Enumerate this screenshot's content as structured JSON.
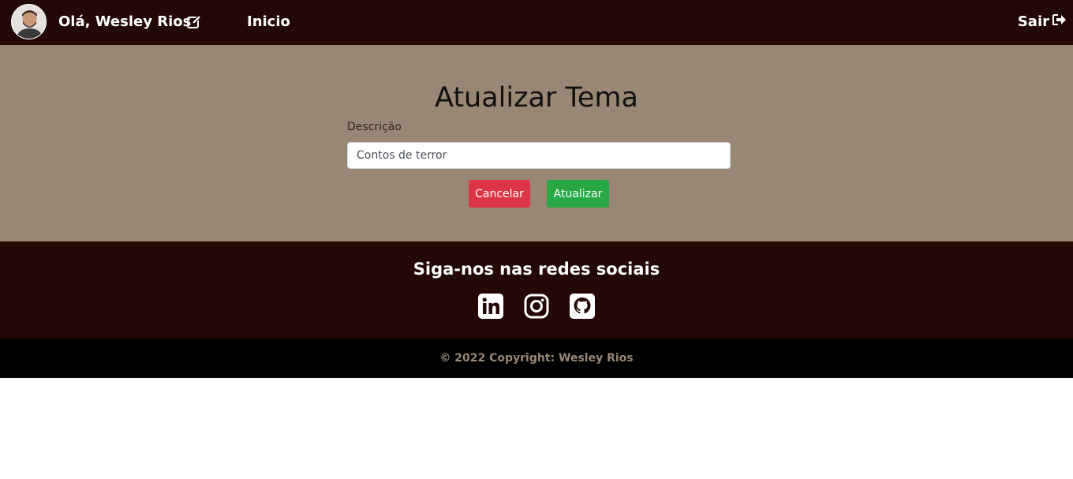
{
  "header": {
    "greeting": "Olá, Wesley Rios",
    "nav_home": "Inicio",
    "logout_label": "Sair"
  },
  "form": {
    "title": "Atualizar Tema",
    "description_label": "Descrição",
    "description_value": "Contos de terror",
    "cancel_label": "Cancelar",
    "submit_label": "Atualizar"
  },
  "footer": {
    "social_title": "Siga-nos nas redes sociais",
    "social_icons": [
      "linkedin-icon",
      "instagram-icon",
      "github-icon"
    ],
    "copyright": "© 2022 Copyright: Wesley Rios"
  },
  "colors": {
    "header_bg": "#240805",
    "main_bg": "#998775",
    "cancel": "#dc3545",
    "submit": "#28a745",
    "copyright_bg": "#000000"
  }
}
